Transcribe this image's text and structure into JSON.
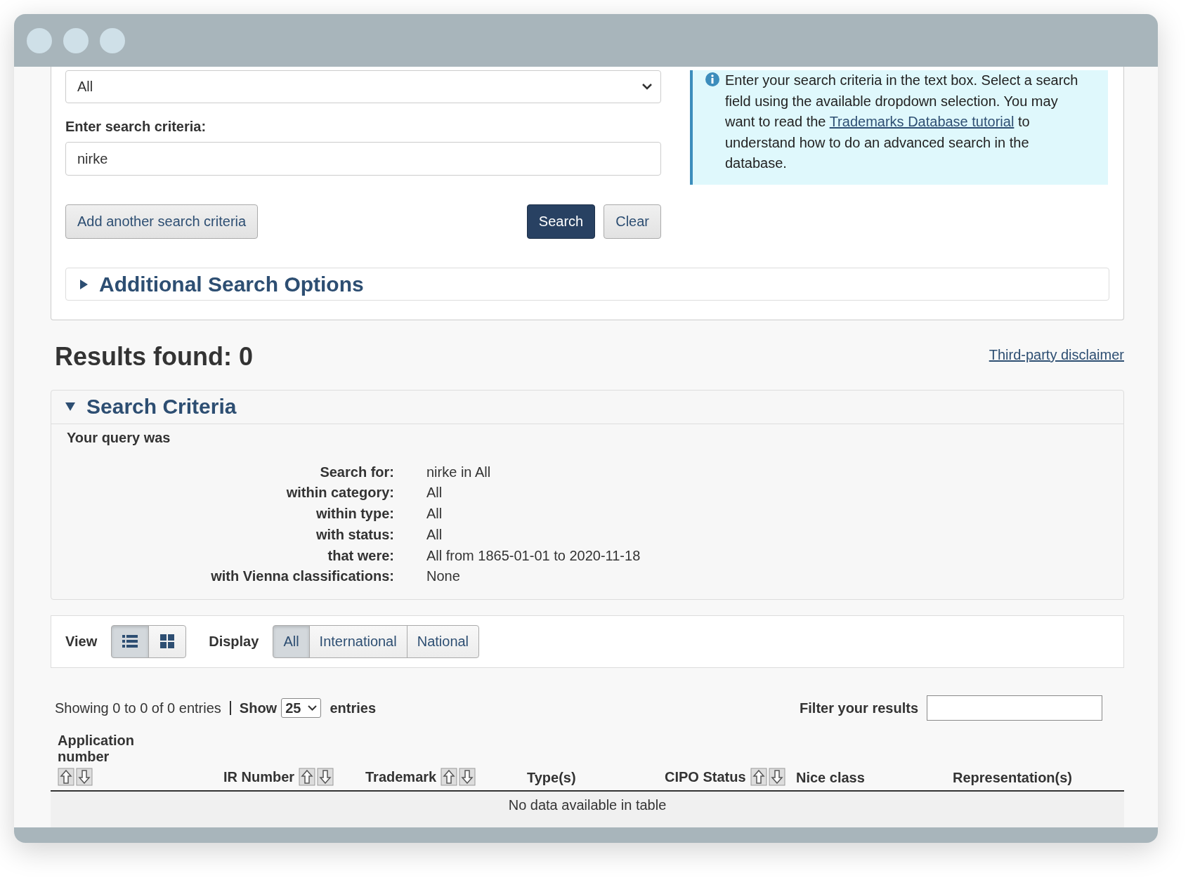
{
  "search_form": {
    "field_select": {
      "value": "All"
    },
    "criteria_label": "Enter search criteria:",
    "criteria_input": {
      "value": "nirke"
    },
    "buttons": [
      {
        "label": "Add another search criteria",
        "kind": "secondary"
      },
      {
        "label": "Search",
        "kind": "primary"
      },
      {
        "label": "Clear",
        "kind": "secondary"
      }
    ],
    "info": {
      "text_before": "Enter your search criteria in the text box. Select a search field using the available dropdown selection. You may want to read the",
      "link": "Trademarks Database tutorial",
      "text_after": "to understand how to do an advanced search in the database."
    },
    "additional_options": {
      "label": "Additional Search Options",
      "expanded": false
    }
  },
  "results": {
    "title": "Results found: 0",
    "disclaimer_link": "Third-party disclaimer"
  },
  "criteria_panel": {
    "title": "Search Criteria",
    "expanded": true,
    "intro": "Your query was",
    "rows": [
      {
        "label": "Search for:",
        "value": "nirke in All"
      },
      {
        "label": "within category:",
        "value": "All"
      },
      {
        "label": "within type:",
        "value": "All"
      },
      {
        "label": "with status:",
        "value": "All"
      },
      {
        "label": "that were:",
        "value": "All from 1865-01-01 to 2020-11-18"
      },
      {
        "label": "with Vienna classifications:",
        "value": "None"
      }
    ]
  },
  "view_bar": {
    "view_label": "View",
    "views": [
      {
        "kind": "list",
        "selected": true
      },
      {
        "kind": "grid",
        "selected": false
      }
    ],
    "display_label": "Display",
    "display_options": [
      {
        "label": "All",
        "selected": true
      },
      {
        "label": "International",
        "selected": false
      },
      {
        "label": "National",
        "selected": false
      }
    ]
  },
  "table_controls": {
    "showing": "Showing 0 to 0 of 0 entries",
    "show_label": "Show",
    "page_size": "25",
    "entries_label": "entries",
    "filter_label": "Filter your results"
  },
  "table": {
    "columns": [
      {
        "label": "Application number",
        "sortable": true
      },
      {
        "label": "IR Number",
        "sortable": true
      },
      {
        "label": "Trademark",
        "sortable": true
      },
      {
        "label": "Type(s)",
        "sortable": false
      },
      {
        "label": "CIPO Status",
        "sortable": true
      },
      {
        "label": "Nice class",
        "sortable": false
      },
      {
        "label": "Representation(s)",
        "sortable": false
      }
    ],
    "empty_message": "No data available in table"
  }
}
